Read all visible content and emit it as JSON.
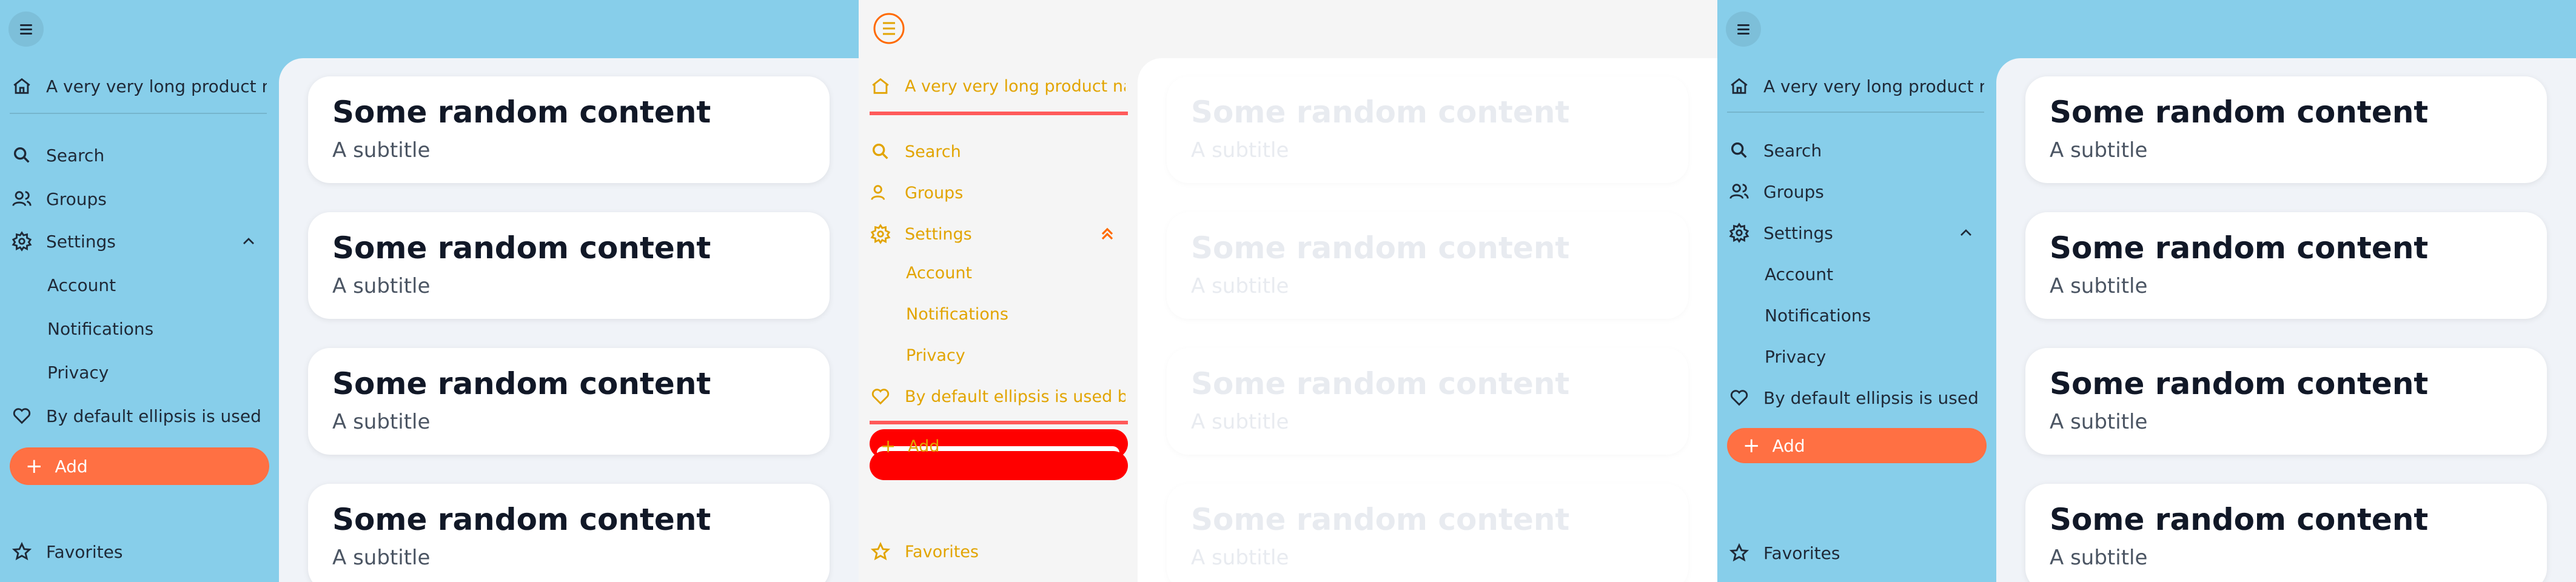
{
  "colors": {
    "sidebar_bg": "#87ceea",
    "accent": "#ff7043",
    "debug_text": "#e2a400",
    "debug_red": "#ff0000"
  },
  "nav": {
    "product_name": "A very very long product name",
    "search": "Search",
    "groups": "Groups",
    "settings": "Settings",
    "account": "Account",
    "notifications": "Notifications",
    "privacy": "Privacy",
    "long_item": "By default ellipsis is used but",
    "add": "Add",
    "favorites": "Favorites"
  },
  "cards": [
    {
      "title": "Some random content",
      "subtitle": "A subtitle"
    },
    {
      "title": "Some random content",
      "subtitle": "A subtitle"
    },
    {
      "title": "Some random content",
      "subtitle": "A subtitle"
    },
    {
      "title": "Some random content",
      "subtitle": "A subtitle"
    }
  ],
  "icons": [
    "menu-icon",
    "home-icon",
    "search-icon",
    "groups-icon",
    "settings-icon",
    "chevron-up-icon",
    "heart-icon",
    "plus-icon",
    "star-icon"
  ]
}
